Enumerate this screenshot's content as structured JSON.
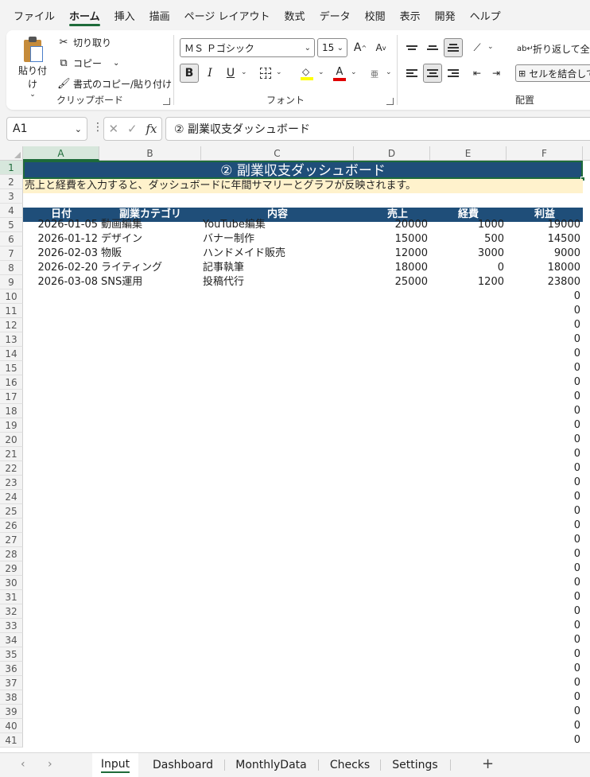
{
  "menu": [
    "ファイル",
    "ホーム",
    "挿入",
    "描画",
    "ページ レイアウト",
    "数式",
    "データ",
    "校閲",
    "表示",
    "開発",
    "ヘルプ"
  ],
  "ribbon": {
    "clipboard": {
      "paste": "貼り付け",
      "cut": "切り取り",
      "copy": "コピー",
      "format_painter": "書式のコピー/貼り付け",
      "label": "クリップボード"
    },
    "font": {
      "name": "ＭＳ Ｐゴシック",
      "size": "15",
      "grow": "A",
      "shrink": "A",
      "bold": "B",
      "italic": "I",
      "underline": "U",
      "font_color_glyph": "A",
      "phonetic_glyph": "亜",
      "label": "フォント"
    },
    "alignment": {
      "wrap_text": "折り返して全体を表示する",
      "merge": "セルを結合して中央揃え",
      "label": "配置"
    }
  },
  "formula_bar": {
    "name_box": "A1",
    "fx": "fx",
    "content": "② 副業収支ダッシュボード"
  },
  "columns": [
    "A",
    "B",
    "C",
    "D",
    "E",
    "F"
  ],
  "rows": [
    "1",
    "2",
    "3",
    "4",
    "5",
    "6",
    "7",
    "8",
    "9",
    "10",
    "11",
    "12",
    "13",
    "14",
    "15",
    "16",
    "17",
    "18",
    "19",
    "20",
    "21",
    "22",
    "23",
    "24",
    "25",
    "26",
    "27",
    "28",
    "29",
    "30",
    "31",
    "32",
    "33",
    "34",
    "35",
    "36",
    "37",
    "38",
    "39",
    "40",
    "41"
  ],
  "sheet": {
    "title": "② 副業収支ダッシュボード",
    "note": "売上と経費を入力すると、ダッシュボードに年間サマリーとグラフが反映されます。",
    "headers": [
      "日付",
      "副業カテゴリ",
      "内容",
      "売上",
      "経費",
      "利益"
    ],
    "data_rows": [
      [
        "2026-01-05",
        "動画編集",
        "YouTube編集",
        "20000",
        "1000",
        "19000"
      ],
      [
        "2026-01-12",
        "デザイン",
        "バナー制作",
        "15000",
        "500",
        "14500"
      ],
      [
        "2026-02-03",
        "物販",
        "ハンドメイド販売",
        "12000",
        "3000",
        "9000"
      ],
      [
        "2026-02-20",
        "ライティング",
        "記事執筆",
        "18000",
        "0",
        "18000"
      ],
      [
        "2026-03-08",
        "SNS運用",
        "投稿代行",
        "25000",
        "1200",
        "23800"
      ]
    ],
    "empty_profit": "0"
  },
  "tabs": [
    "Input",
    "Dashboard",
    "MonthlyData",
    "Checks",
    "Settings"
  ],
  "active_tab": "Input",
  "add_sheet": "+",
  "colors": {
    "accent_green": "#1e6b3a",
    "header_navy": "#1f4e79",
    "note_yellow": "#fff2cc"
  }
}
